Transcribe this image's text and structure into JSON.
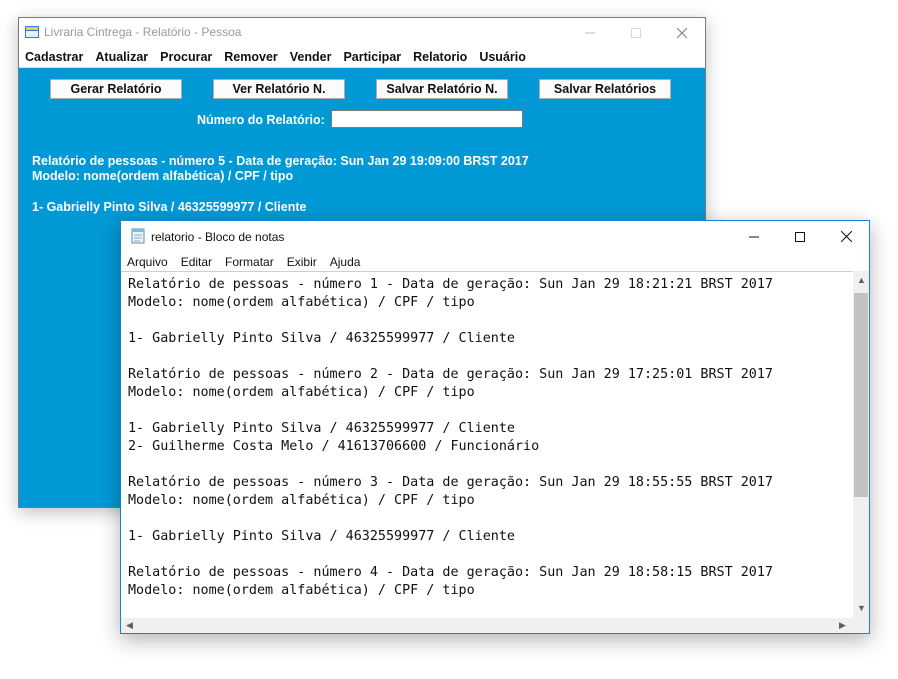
{
  "back_window": {
    "title": "Livraria Cintrega - Relatório - Pessoa",
    "menu": [
      "Cadastrar",
      "Atualizar",
      "Procurar",
      "Remover",
      "Vender",
      "Participar",
      "Relatorio",
      "Usuário"
    ],
    "buttons": {
      "gerar": "Gerar Relatório",
      "ver": "Ver Relatório N.",
      "salvar": "Salvar Relatório N.",
      "salvar_todos": "Salvar Relatórios"
    },
    "numero_label": "Número do Relatório:",
    "numero_value": "",
    "report_lines": [
      "Relatório de pessoas - número 5 - Data de geração: Sun Jan 29 19:09:00 BRST 2017",
      "Modelo: nome(ordem alfabética) / CPF / tipo",
      "1- Gabrielly Pinto Silva / 46325599977 / Cliente"
    ],
    "accent_color": "#0099d6"
  },
  "notepad": {
    "title": "relatorio - Bloco de notas",
    "menu": [
      "Arquivo",
      "Editar",
      "Formatar",
      "Exibir",
      "Ajuda"
    ],
    "lines": [
      "Relatório de pessoas - número 1 - Data de geração: Sun Jan 29 18:21:21 BRST 2017",
      "Modelo: nome(ordem alfabética) / CPF / tipo",
      "",
      "1- Gabrielly Pinto Silva / 46325599977 / Cliente",
      "",
      "Relatório de pessoas - número 2 - Data de geração: Sun Jan 29 17:25:01 BRST 2017",
      "Modelo: nome(ordem alfabética) / CPF / tipo",
      "",
      "1- Gabrielly Pinto Silva / 46325599977 / Cliente",
      "2- Guilherme Costa Melo / 41613706600 / Funcionário",
      "",
      "Relatório de pessoas - número 3 - Data de geração: Sun Jan 29 18:55:55 BRST 2017",
      "Modelo: nome(ordem alfabética) / CPF / tipo",
      "",
      "1- Gabrielly Pinto Silva / 46325599977 / Cliente",
      "",
      "Relatório de pessoas - número 4 - Data de geração: Sun Jan 29 18:58:15 BRST 2017",
      "Modelo: nome(ordem alfabética) / CPF / tipo"
    ]
  }
}
